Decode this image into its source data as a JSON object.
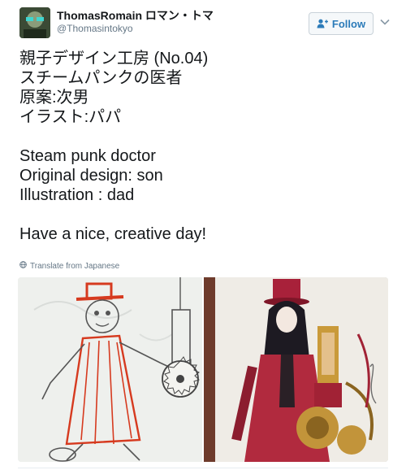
{
  "author": {
    "display_name": "ThomasRomain ロマン・トマ",
    "handle": "@Thomasintokyo"
  },
  "follow_button": {
    "label": "Follow"
  },
  "tweet": {
    "lines": [
      "親子デザイン工房 (No.04)",
      "スチームパンクの医者",
      "原案:次男",
      "イラスト:パパ",
      "",
      "Steam punk doctor",
      "Original design: son",
      "Illustration : dad",
      "",
      "Have a nice, creative day!"
    ]
  },
  "translate_link": {
    "label": "Translate from Japanese"
  },
  "media": {
    "photos": [
      {
        "subject": "child crayon drawing of a steampunk doctor with a saw"
      },
      {
        "subject": "illustrated steampunk doctor with top hat and brass machine"
      }
    ]
  },
  "icons": {
    "follow": "person-plus-icon",
    "menu": "chevron-down-icon",
    "translate": "globe-icon"
  },
  "colors": {
    "link": "#2b7bb9",
    "secondary_text": "#657786",
    "primary_text": "#14171a"
  }
}
